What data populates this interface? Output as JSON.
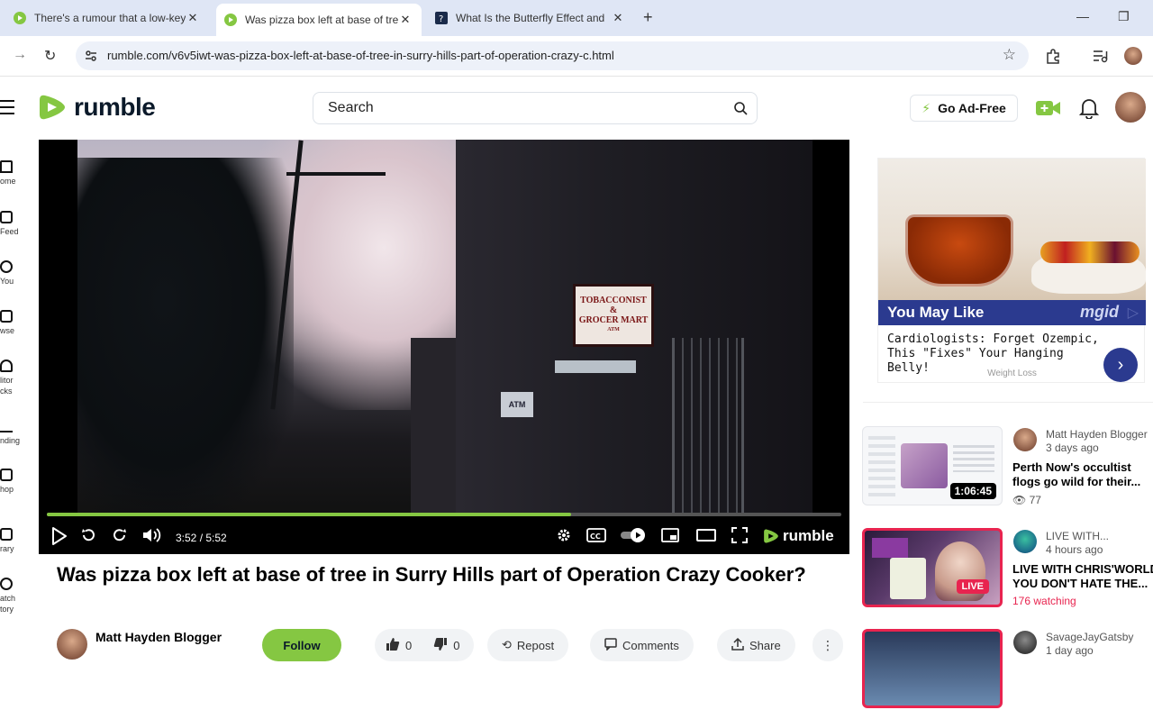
{
  "browser": {
    "tabs": [
      {
        "title": "There's a rumour that a low-key",
        "active": false
      },
      {
        "title": "Was pizza box left at base of tre",
        "active": true
      },
      {
        "title": "What Is the Butterfly Effect and",
        "active": false
      }
    ],
    "new_tab": "+",
    "url": "rumble.com/v6v5iwt-was-pizza-box-left-at-base-of-tree-in-surry-hills-part-of-operation-crazy-c.html"
  },
  "header": {
    "logo_text": "rumble",
    "search_placeholder": "Search",
    "go_ad_free": "Go Ad-Free"
  },
  "sidebar": {
    "items": [
      {
        "label": "ome"
      },
      {
        "label": "Feed"
      },
      {
        "label": "You"
      },
      {
        "label": "wse"
      },
      {
        "label": "litor\ncks"
      },
      {
        "label": "nding"
      },
      {
        "label": "hop"
      },
      {
        "label": "rary"
      },
      {
        "label": "atch\ntory"
      }
    ]
  },
  "player": {
    "time": "3:52 / 5:52",
    "progress": 0.66,
    "logo_text": "rumble",
    "scene": {
      "sign_line1": "TOBACCONIST",
      "sign_line2": "&",
      "sign_line3": "GROCER MART",
      "sign_line4": "ATM",
      "atm": "ATM"
    }
  },
  "video": {
    "title": "Was pizza box left at base of tree in Surry Hills part of Operation Crazy Cooker?",
    "channel": "Matt Hayden Blogger",
    "follow": "Follow",
    "likes": "0",
    "dislikes": "0",
    "repost": "Repost",
    "comments": "Comments",
    "share": "Share"
  },
  "ad": {
    "band_label": "You May Like",
    "brand": "mgid",
    "text": "Cardiologists: Forget Ozempic, This \"Fixes\" Your Hanging Belly!",
    "category": "Weight Loss"
  },
  "recommendations": [
    {
      "channel": "Matt Hayden Blogger",
      "ago": "3 days ago",
      "title": "Perth Now's occultist flogs go wild for their...",
      "duration": "1:06:45",
      "views": "77"
    },
    {
      "channel": "LIVE WITH...",
      "ago": "4 hours ago",
      "title": "LIVE WITH CHRIS'WORLD - YOU DON'T HATE THE...",
      "live": "LIVE",
      "watching": "176 watching"
    },
    {
      "channel": "SavageJayGatsby",
      "ago": "1 day ago"
    }
  ],
  "colors": {
    "brand_green": "#85c742",
    "live_red": "#e8244f",
    "mgid_blue": "#2b3a8f"
  }
}
